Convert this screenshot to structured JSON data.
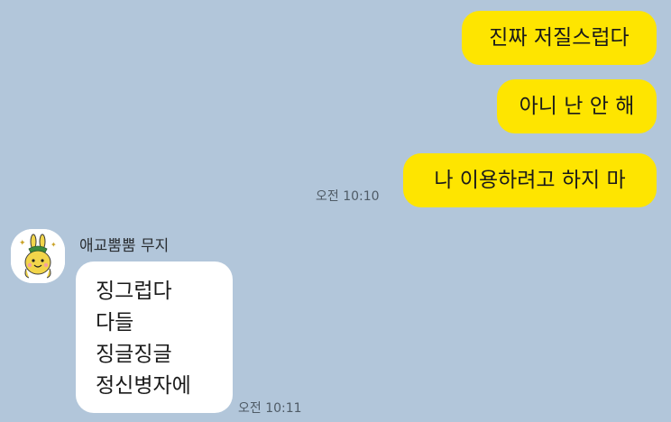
{
  "outgoing": [
    {
      "text": "진짜 저질스럽다"
    },
    {
      "text": "아니 난 안 해"
    },
    {
      "text": "나 이용하려고 하지 마"
    }
  ],
  "outgoing_time": "오전 10:10",
  "incoming": {
    "sender": "애교뿜뿜 무지",
    "avatar_icon": "muzi-character-icon",
    "lines": [
      "징그럽다",
      "다들",
      "징글징글",
      "정신병자에"
    ],
    "time": "오전 10:11"
  },
  "colors": {
    "background": "#b2c6da",
    "my_bubble": "#fee500",
    "their_bubble": "#ffffff"
  }
}
